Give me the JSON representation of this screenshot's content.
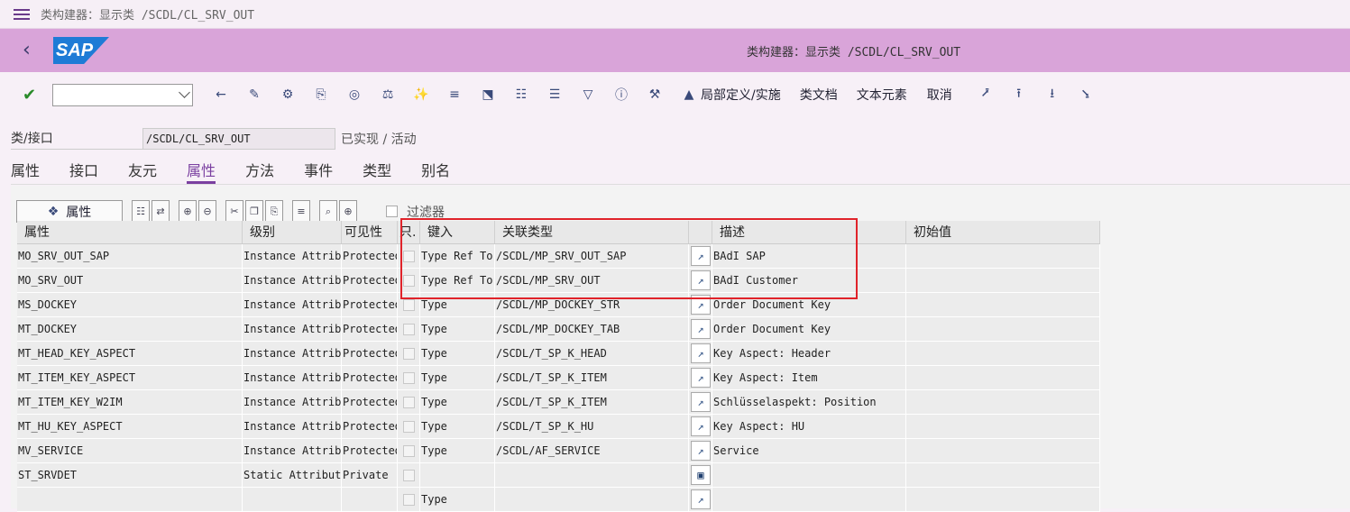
{
  "window": {
    "title": "类构建器：显示类 /SCDL/CL_SRV_OUT"
  },
  "header": {
    "logo": "SAP",
    "title": "类构建器：显示类 /SCDL/CL_SRV_OUT"
  },
  "toolbar": {
    "command_value": "",
    "text_buttons": [
      "局部定义/实施",
      "类文档",
      "文本元素",
      "取消"
    ]
  },
  "classinfo": {
    "label": "类/接口",
    "value": "/SCDL/CL_SRV_OUT",
    "status": "已实现 / 活动"
  },
  "tabs": [
    "属性",
    "接口",
    "友元",
    "属性",
    "方法",
    "事件",
    "类型",
    "别名"
  ],
  "active_tab_index": 3,
  "panel": {
    "attr_button": "属性",
    "filter_label": "过滤器"
  },
  "table": {
    "headers": [
      "属性",
      "级别",
      "可见性",
      "只.",
      "键入",
      "关联类型",
      "",
      "描述",
      "初始值"
    ],
    "rows": [
      {
        "name": "MO_SRV_OUT_SAP",
        "level": "Instance Attribute",
        "vis": "Protected",
        "typing": "Type Ref To",
        "assoc": "/SCDL/MP_SRV_OUT_SAP",
        "desc": "BAdI SAP",
        "init": ""
      },
      {
        "name": "MO_SRV_OUT",
        "level": "Instance Attribute",
        "vis": "Protected",
        "typing": "Type Ref To",
        "assoc": "/SCDL/MP_SRV_OUT",
        "desc": "BAdI Customer",
        "init": ""
      },
      {
        "name": "MS_DOCKEY",
        "level": "Instance Attribute",
        "vis": "Protected",
        "typing": "Type",
        "assoc": "/SCDL/MP_DOCKEY_STR",
        "desc": "Order Document Key",
        "init": ""
      },
      {
        "name": "MT_DOCKEY",
        "level": "Instance Attribute",
        "vis": "Protected",
        "typing": "Type",
        "assoc": "/SCDL/MP_DOCKEY_TAB",
        "desc": "Order Document Key",
        "init": ""
      },
      {
        "name": "MT_HEAD_KEY_ASPECT",
        "level": "Instance Attribute",
        "vis": "Protected",
        "typing": "Type",
        "assoc": "/SCDL/T_SP_K_HEAD",
        "desc": "Key Aspect: Header",
        "init": ""
      },
      {
        "name": "MT_ITEM_KEY_ASPECT",
        "level": "Instance Attribute",
        "vis": "Protected",
        "typing": "Type",
        "assoc": "/SCDL/T_SP_K_ITEM",
        "desc": "Key Aspect: Item",
        "init": ""
      },
      {
        "name": "MT_ITEM_KEY_W2IM",
        "level": "Instance Attribute",
        "vis": "Protected",
        "typing": "Type",
        "assoc": "/SCDL/T_SP_K_ITEM",
        "desc": "Schlüsselaspekt: Position",
        "init": ""
      },
      {
        "name": "MT_HU_KEY_ASPECT",
        "level": "Instance Attribute",
        "vis": "Protected",
        "typing": "Type",
        "assoc": "/SCDL/T_SP_K_HU",
        "desc": "Key Aspect: HU",
        "init": ""
      },
      {
        "name": "MV_SERVICE",
        "level": "Instance Attribute",
        "vis": "Protected",
        "typing": "Type",
        "assoc": "/SCDL/AF_SERVICE",
        "desc": "Service",
        "init": ""
      },
      {
        "name": "ST_SRVDET",
        "level": "Static Attribute",
        "vis": "Private",
        "typing": "",
        "assoc": "",
        "desc": "",
        "init": ""
      },
      {
        "name": "",
        "level": "",
        "vis": "",
        "typing": "Type",
        "assoc": "",
        "desc": "",
        "init": ""
      }
    ]
  }
}
